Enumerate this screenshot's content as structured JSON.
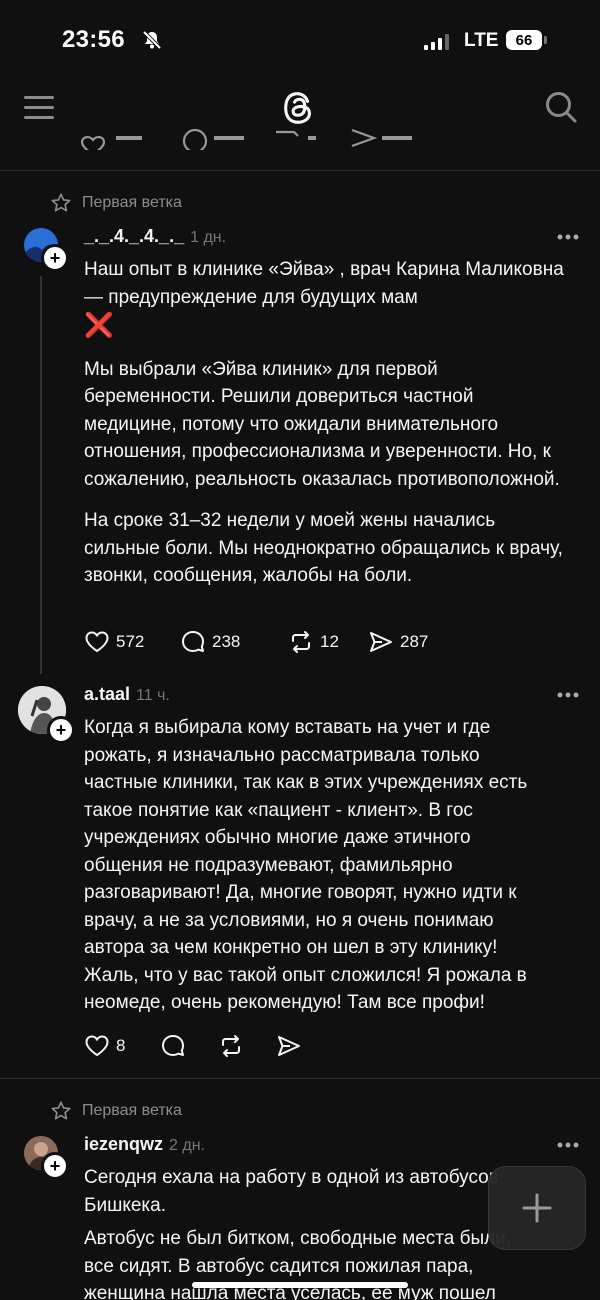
{
  "status_bar": {
    "time": "23:56",
    "network": "LTE",
    "battery": "66"
  },
  "feed": {
    "posts": [
      {
        "thread_label": "Первая ветка",
        "username": "_._.4._.4._._",
        "time": "1 дн.",
        "title": "Наш опыт в клинике «Эйва» , врач Карина Маликовна — предупреждение для будущих мам",
        "title_emoji": "❌",
        "paragraphs": [
          "Мы выбрали «Эйва клиник» для первой беременности. Решили довериться частной медицине, потому что ожидали внимательного отношения, профессионализма и уверенности. Но, к сожалению, реальность оказалась противоположной.",
          "На сроке 31–32 недели у моей жены начались сильные боли. Мы неоднократно обращались к врачу, звонки, сообщения, жалобы на боли."
        ],
        "stats": {
          "likes": "572",
          "replies": "238",
          "reposts": "12",
          "shares": "287"
        }
      },
      {
        "username": "a.taal",
        "time": "11 ч.",
        "text": "Когда я выбирала кому вставать на учет и где рожать, я изначально рассматривала только частные клиники, так как в этих учреждениях есть такое понятие как «пациент - клиент». В гос учреждениях обычно многие даже этичного общения не подразумевают, фамильярно разговаривают! Да, многие говорят, нужно идти к врачу, а не за условиями, но я очень понимаю автора за чем конкретно он шел в эту клинику! Жаль, что у вас такой опыт сложился! Я рожала в неомеде, очень рекомендую! Там все профи!",
        "stats": {
          "likes": "8"
        }
      },
      {
        "thread_label": "Первая ветка",
        "username": "iezenqwz",
        "time": "2 дн.",
        "lines": [
          "Сегодня ехала на работу в одной из автобусов",
          "Бишкека.",
          "Автобус не был битком, свободные места были,",
          "все сидят. В автобус садится пожилая пара,",
          "женщина нашла места уселась, её муж пошел"
        ]
      }
    ]
  },
  "icons": {
    "header": [
      "menu-icon",
      "threads-logo",
      "search-icon"
    ],
    "actions": [
      "heart-icon",
      "comment-icon",
      "repost-icon",
      "share-icon"
    ],
    "fab": "plus-icon"
  }
}
